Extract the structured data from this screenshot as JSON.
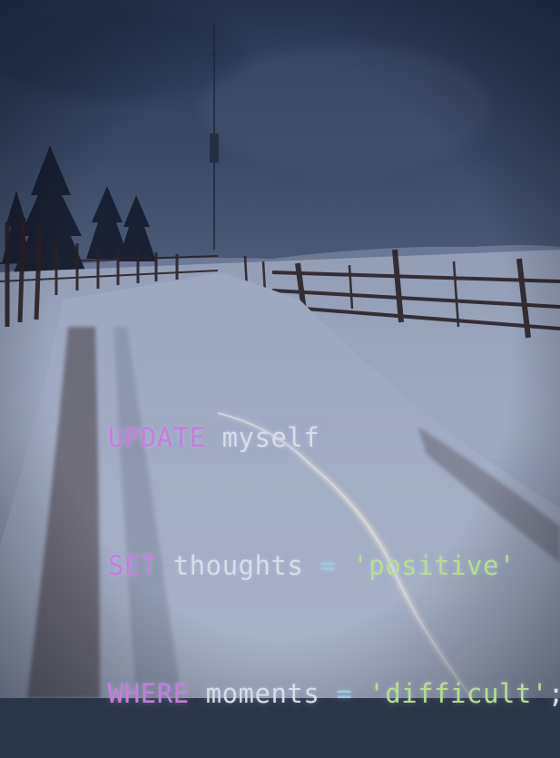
{
  "code": {
    "lines": [
      {
        "tokens": [
          {
            "text": "UPDATE",
            "kind": "keyword"
          },
          {
            "text": " ",
            "kind": "space"
          },
          {
            "text": "myself",
            "kind": "identifier"
          }
        ]
      },
      {
        "tokens": [
          {
            "text": "SET",
            "kind": "keyword"
          },
          {
            "text": " ",
            "kind": "space"
          },
          {
            "text": "thoughts",
            "kind": "identifier"
          },
          {
            "text": " ",
            "kind": "space"
          },
          {
            "text": "=",
            "kind": "operator"
          },
          {
            "text": " ",
            "kind": "space"
          },
          {
            "text": "'positive'",
            "kind": "string"
          }
        ]
      },
      {
        "tokens": [
          {
            "text": "WHERE",
            "kind": "keyword"
          },
          {
            "text": " ",
            "kind": "space"
          },
          {
            "text": "moments",
            "kind": "identifier"
          },
          {
            "text": " ",
            "kind": "space"
          },
          {
            "text": "=",
            "kind": "operator"
          },
          {
            "text": " ",
            "kind": "space"
          },
          {
            "text": "'difficult'",
            "kind": "string"
          },
          {
            "text": ";",
            "kind": "punctuation"
          }
        ]
      }
    ]
  },
  "colors": {
    "keyword": "#c77dde",
    "identifier": "#d9dde6",
    "operator": "#8fd0e8",
    "string": "#b5e08a",
    "punctuation": "#d9dde6",
    "sky": "#3a4964",
    "snow": "#c9d2e4"
  },
  "scene": {
    "elements": [
      "sky",
      "radio-tower",
      "pine-trees",
      "wooden-fence",
      "snowy-road",
      "light-streak"
    ]
  }
}
